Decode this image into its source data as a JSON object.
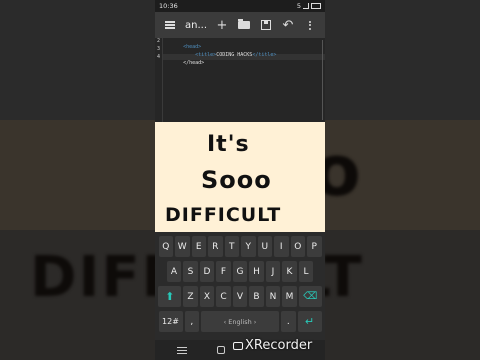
{
  "status_bar": {
    "time": "10:36",
    "right_label": "5"
  },
  "toolbar": {
    "title": "an..."
  },
  "editor": {
    "line_numbers": [
      "2",
      "3",
      "4"
    ],
    "lines": [
      {
        "indent": "<head>",
        "content": ""
      },
      {
        "indent": "    ",
        "open": "<title>",
        "content": "CODING HACKS",
        "close": "</title>"
      },
      {
        "indent": "",
        "open": "",
        "content": "</head>",
        "close": ""
      }
    ]
  },
  "overlay": {
    "line1": "It's",
    "line2": "Sooo",
    "line3": "DIFFICULT"
  },
  "background": {
    "blur_text_1": "Sooo",
    "blur_text_2": "DIFFICULT"
  },
  "keyboard": {
    "row1": [
      "Q",
      "W",
      "E",
      "R",
      "T",
      "Y",
      "U",
      "I",
      "O",
      "P"
    ],
    "row2": [
      "A",
      "S",
      "D",
      "F",
      "G",
      "H",
      "J",
      "K",
      "L"
    ],
    "row3": [
      "Z",
      "X",
      "C",
      "V",
      "B",
      "N",
      "M"
    ],
    "num_label": "12#",
    "space_label": "‹ English ›",
    "comma_label": ",",
    "period_label": "."
  },
  "watermark": {
    "text": "XRecorder"
  },
  "colors": {
    "accent": "#28c8b8",
    "overlay_bg": "#fff1d6",
    "tag": "#4f8fbf"
  }
}
